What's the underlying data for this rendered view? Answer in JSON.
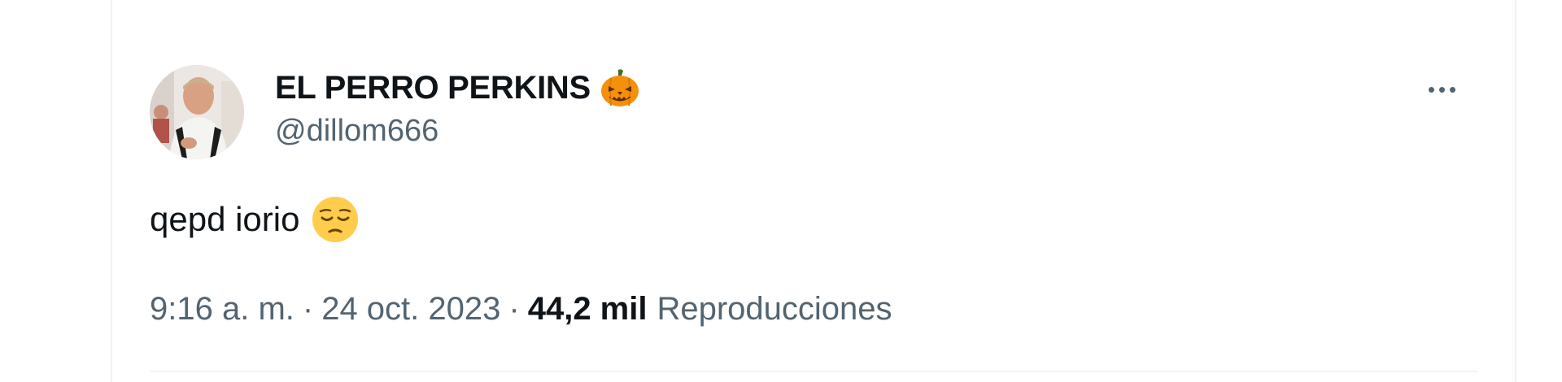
{
  "tweet": {
    "author": {
      "display_name": "EL PERRO PERKINS",
      "name_emoji": "jack-o-lantern",
      "handle": "@dillom666",
      "avatar": "profile-photo"
    },
    "text": "qepd iorio",
    "text_emoji": "pensive-face",
    "more_icon": "more-options-icon",
    "time": "9:16 a. m.",
    "separator": "·",
    "date": "24 oct. 2023",
    "views_count": "44,2 mil",
    "views_label": "Reproducciones"
  },
  "colors": {
    "text_primary": "#0f1419",
    "text_secondary": "#536471",
    "border": "#eff3f4",
    "emoji_orange": "#f4900c",
    "emoji_yellow": "#ffcc4d"
  }
}
